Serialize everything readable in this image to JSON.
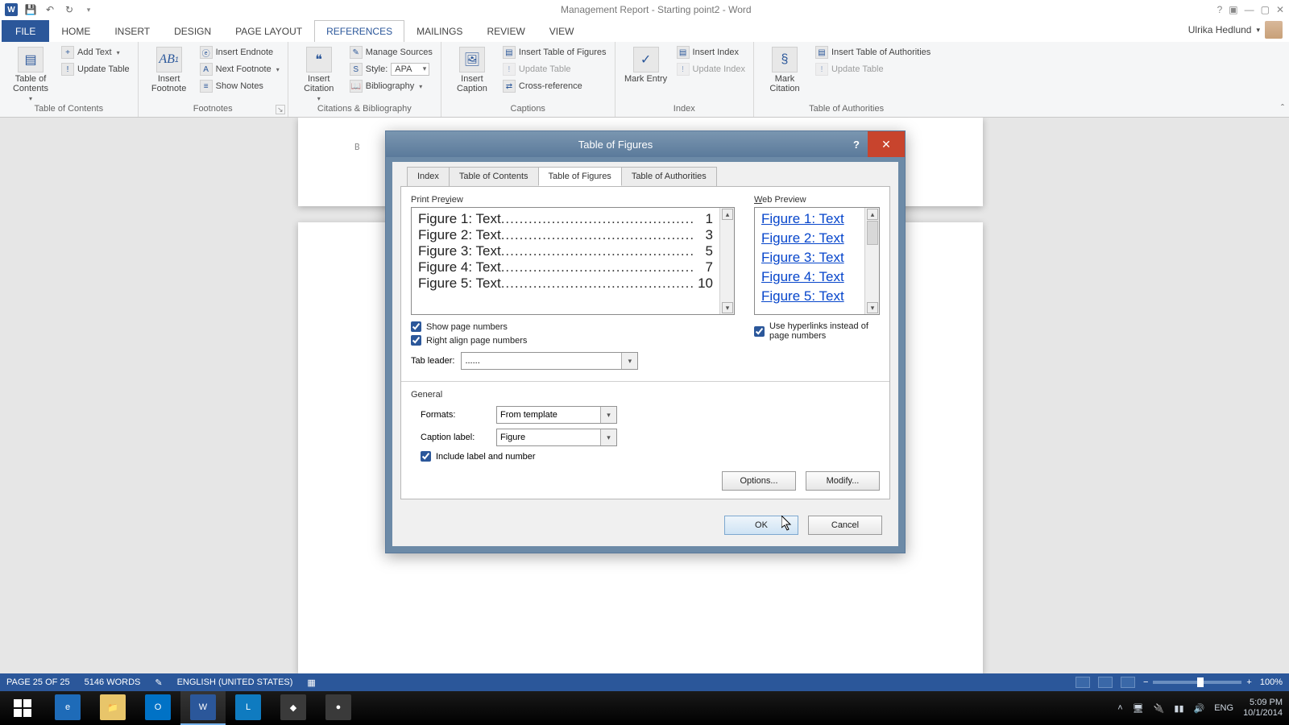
{
  "titlebar": {
    "title": "Management Report - Starting point2 - Word"
  },
  "user": {
    "name": "Ulrika Hedlund"
  },
  "tabs": {
    "file": "FILE",
    "home": "HOME",
    "insert": "INSERT",
    "design": "DESIGN",
    "pagelayout": "PAGE LAYOUT",
    "references": "REFERENCES",
    "mailings": "MAILINGS",
    "review": "REVIEW",
    "view": "VIEW"
  },
  "ribbon": {
    "toc": {
      "big": "Table of Contents",
      "add": "Add Text",
      "update": "Update Table",
      "group": "Table of Contents"
    },
    "footnotes": {
      "big": "Insert Footnote",
      "ab": "AB",
      "endnote": "Insert Endnote",
      "next": "Next Footnote",
      "show": "Show Notes",
      "group": "Footnotes"
    },
    "citations": {
      "big": "Insert Citation",
      "manage": "Manage Sources",
      "style_lbl": "Style:",
      "style_val": "APA",
      "biblio": "Bibliography",
      "group": "Citations & Bibliography"
    },
    "captions": {
      "big": "Insert Caption",
      "tof": "Insert Table of Figures",
      "update": "Update Table",
      "cross": "Cross-reference",
      "group": "Captions"
    },
    "index": {
      "big": "Mark Entry",
      "insert": "Insert Index",
      "update": "Update Index",
      "group": "Index"
    },
    "toa": {
      "big": "Mark Citation",
      "insert": "Insert Table of Authorities",
      "update": "Update Table",
      "group": "Table of Authorities"
    }
  },
  "dialog": {
    "title": "Table of Figures",
    "tabs": {
      "index": "Index",
      "toc": "Table of Contents",
      "tof": "Table of Figures",
      "toa": "Table of Authorities"
    },
    "print_label_pre": "Print Pre",
    "print_label_u": "v",
    "print_label_post": "iew",
    "web_label_pre": "",
    "web_label_u": "W",
    "web_label_post": "eb Preview",
    "print_items": [
      {
        "label": "Figure 1: Text",
        "page": "1"
      },
      {
        "label": "Figure 2: Text",
        "page": "3"
      },
      {
        "label": "Figure 3: Text",
        "page": "5"
      },
      {
        "label": "Figure 4: Text",
        "page": "7"
      },
      {
        "label": "Figure 5: Text",
        "page": "10"
      }
    ],
    "web_items": [
      "Figure 1: Text",
      "Figure 2: Text",
      "Figure 3: Text",
      "Figure 4: Text",
      "Figure 5: Text"
    ],
    "chk_show_pn": "Show page numbers",
    "chk_right_align": "Right align page numbers",
    "chk_hyperlinks": "Use hyperlinks instead of page numbers",
    "tab_leader_lbl": "Tab leader:",
    "tab_leader_val": "......",
    "general": "General",
    "formats_lbl": "Formats:",
    "formats_val": "From template",
    "caption_lbl": "Caption label:",
    "caption_val": "Figure",
    "chk_include": "Include label and number",
    "options": "Options...",
    "modify": "Modify...",
    "ok": "OK",
    "cancel": "Cancel"
  },
  "page": {
    "partial_text": "B"
  },
  "status": {
    "page": "PAGE 25 OF 25",
    "words": "5146 WORDS",
    "lang": "ENGLISH (UNITED STATES)",
    "zoom": "100%"
  },
  "taskbar": {
    "lang": "ENG",
    "time": "5:09 PM",
    "date": "10/1/2014"
  }
}
